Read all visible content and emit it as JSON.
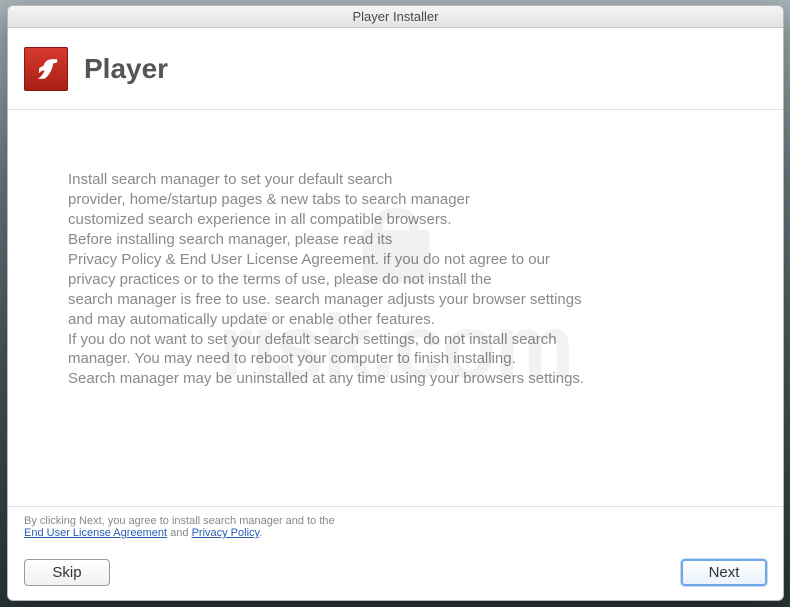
{
  "titlebar": {
    "text": "Player Installer"
  },
  "header": {
    "app_title": "Player",
    "icon": "flash-icon"
  },
  "body": {
    "lines": [
      "Install search manager to set your default search",
      "provider, home/startup pages & new tabs to search manager",
      "customized search experience in all compatible browsers.",
      "Before installing search manager, please read its",
      "Privacy Policy & End User License Agreement. if you do not agree to our",
      "privacy practices or to the terms of use, please do not install the",
      "search manager is free to use. search manager adjusts your browser settings",
      "and may automatically update or enable other features.",
      "If you do not want to set your default search settings, do not install search",
      "manager. You may need to reboot your computer to finish installing.",
      "Search manager may be uninstalled at any time using your browsers settings."
    ]
  },
  "footer": {
    "prefix": "By clicking Next, you agree to install search manager and to the",
    "eula_label": "End User License Agreement",
    "separator": " and ",
    "privacy_label": "Privacy Policy",
    "suffix": "."
  },
  "buttons": {
    "skip_label": "Skip",
    "next_label": "Next"
  },
  "watermark": {
    "text": "risk.com"
  }
}
